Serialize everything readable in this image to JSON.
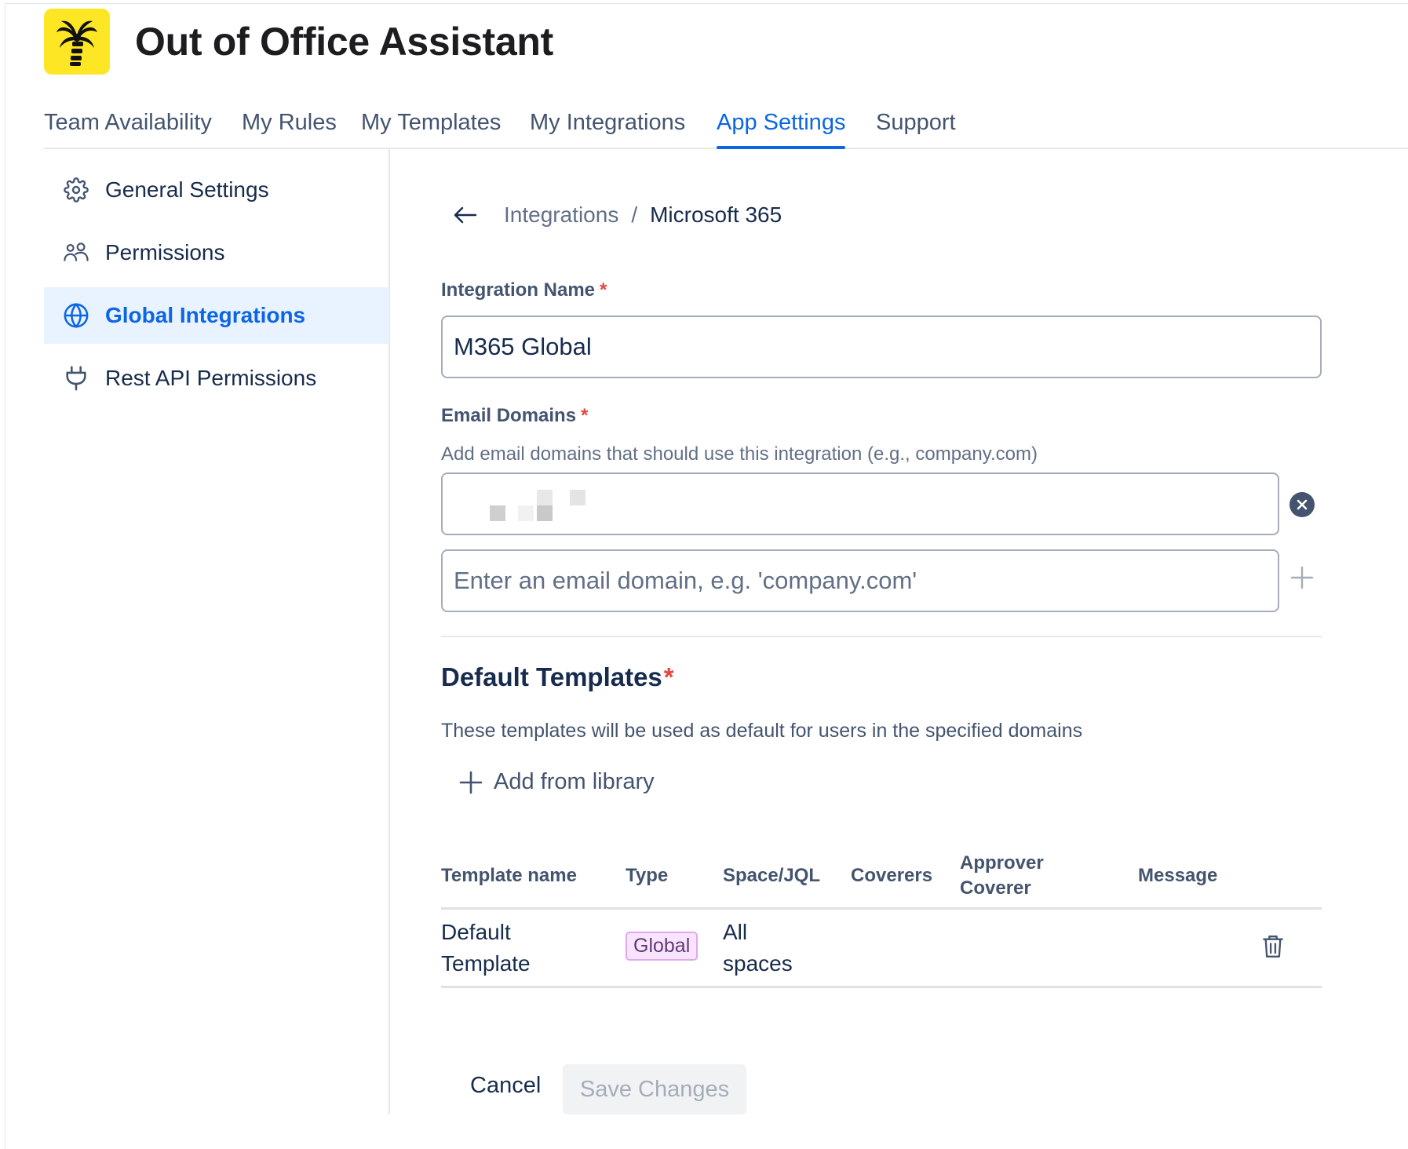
{
  "app": {
    "title": "Out of Office Assistant",
    "logo_icon": "palm-tree-icon",
    "accent": "#0c66e4",
    "logo_bg": "#fde724"
  },
  "tabs": [
    {
      "label": "Team Availability"
    },
    {
      "label": "My Rules"
    },
    {
      "label": "My Templates"
    },
    {
      "label": "My Integrations"
    },
    {
      "label": "App Settings",
      "active": true
    },
    {
      "label": "Support"
    }
  ],
  "sidebar": {
    "items": [
      {
        "label": "General Settings",
        "icon": "gear-icon"
      },
      {
        "label": "Permissions",
        "icon": "users-icon"
      },
      {
        "label": "Global Integrations",
        "icon": "globe-icon",
        "active": true
      },
      {
        "label": "Rest API Permissions",
        "icon": "plug-icon"
      }
    ]
  },
  "breadcrumb": {
    "parent": "Integrations",
    "separator": "/",
    "current": "Microsoft 365"
  },
  "form": {
    "integration_name": {
      "label": "Integration Name",
      "required_mark": "*",
      "value": "M365 Global"
    },
    "email_domains": {
      "label": "Email Domains",
      "required_mark": "*",
      "hint": "Add email domains that should use this integration (e.g., company.com)",
      "new_placeholder": "Enter an email domain, e.g. 'company.com'"
    }
  },
  "templates": {
    "title": "Default Templates",
    "required_mark": "*",
    "description": "These templates will be used as default for users in the specified domains",
    "add_label": "Add from library",
    "columns": [
      "Template name",
      "Type",
      "Space/JQL",
      "Coverers",
      "Approver Coverer",
      "Message"
    ],
    "rows": [
      {
        "name": "Default Template",
        "type": "Global",
        "space": "All spaces",
        "coverers": "",
        "approver": "",
        "message": ""
      }
    ]
  },
  "actions": {
    "cancel": "Cancel",
    "save": "Save Changes"
  }
}
